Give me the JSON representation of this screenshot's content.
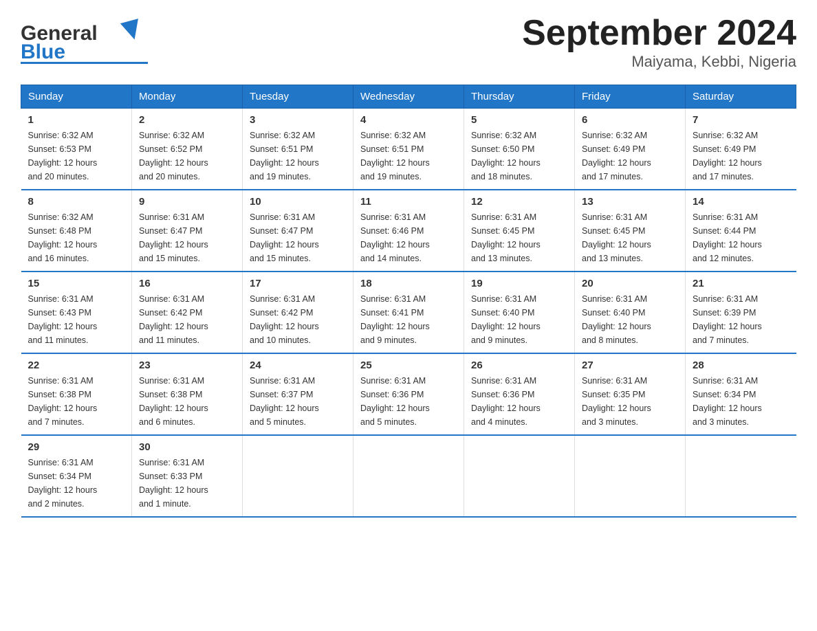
{
  "header": {
    "logo_general": "General",
    "logo_blue": "Blue",
    "title": "September 2024",
    "location": "Maiyama, Kebbi, Nigeria"
  },
  "calendar": {
    "days_of_week": [
      "Sunday",
      "Monday",
      "Tuesday",
      "Wednesday",
      "Thursday",
      "Friday",
      "Saturday"
    ],
    "weeks": [
      [
        {
          "day": "1",
          "info": "Sunrise: 6:32 AM\nSunset: 6:53 PM\nDaylight: 12 hours\nand 20 minutes."
        },
        {
          "day": "2",
          "info": "Sunrise: 6:32 AM\nSunset: 6:52 PM\nDaylight: 12 hours\nand 20 minutes."
        },
        {
          "day": "3",
          "info": "Sunrise: 6:32 AM\nSunset: 6:51 PM\nDaylight: 12 hours\nand 19 minutes."
        },
        {
          "day": "4",
          "info": "Sunrise: 6:32 AM\nSunset: 6:51 PM\nDaylight: 12 hours\nand 19 minutes."
        },
        {
          "day": "5",
          "info": "Sunrise: 6:32 AM\nSunset: 6:50 PM\nDaylight: 12 hours\nand 18 minutes."
        },
        {
          "day": "6",
          "info": "Sunrise: 6:32 AM\nSunset: 6:49 PM\nDaylight: 12 hours\nand 17 minutes."
        },
        {
          "day": "7",
          "info": "Sunrise: 6:32 AM\nSunset: 6:49 PM\nDaylight: 12 hours\nand 17 minutes."
        }
      ],
      [
        {
          "day": "8",
          "info": "Sunrise: 6:32 AM\nSunset: 6:48 PM\nDaylight: 12 hours\nand 16 minutes."
        },
        {
          "day": "9",
          "info": "Sunrise: 6:31 AM\nSunset: 6:47 PM\nDaylight: 12 hours\nand 15 minutes."
        },
        {
          "day": "10",
          "info": "Sunrise: 6:31 AM\nSunset: 6:47 PM\nDaylight: 12 hours\nand 15 minutes."
        },
        {
          "day": "11",
          "info": "Sunrise: 6:31 AM\nSunset: 6:46 PM\nDaylight: 12 hours\nand 14 minutes."
        },
        {
          "day": "12",
          "info": "Sunrise: 6:31 AM\nSunset: 6:45 PM\nDaylight: 12 hours\nand 13 minutes."
        },
        {
          "day": "13",
          "info": "Sunrise: 6:31 AM\nSunset: 6:45 PM\nDaylight: 12 hours\nand 13 minutes."
        },
        {
          "day": "14",
          "info": "Sunrise: 6:31 AM\nSunset: 6:44 PM\nDaylight: 12 hours\nand 12 minutes."
        }
      ],
      [
        {
          "day": "15",
          "info": "Sunrise: 6:31 AM\nSunset: 6:43 PM\nDaylight: 12 hours\nand 11 minutes."
        },
        {
          "day": "16",
          "info": "Sunrise: 6:31 AM\nSunset: 6:42 PM\nDaylight: 12 hours\nand 11 minutes."
        },
        {
          "day": "17",
          "info": "Sunrise: 6:31 AM\nSunset: 6:42 PM\nDaylight: 12 hours\nand 10 minutes."
        },
        {
          "day": "18",
          "info": "Sunrise: 6:31 AM\nSunset: 6:41 PM\nDaylight: 12 hours\nand 9 minutes."
        },
        {
          "day": "19",
          "info": "Sunrise: 6:31 AM\nSunset: 6:40 PM\nDaylight: 12 hours\nand 9 minutes."
        },
        {
          "day": "20",
          "info": "Sunrise: 6:31 AM\nSunset: 6:40 PM\nDaylight: 12 hours\nand 8 minutes."
        },
        {
          "day": "21",
          "info": "Sunrise: 6:31 AM\nSunset: 6:39 PM\nDaylight: 12 hours\nand 7 minutes."
        }
      ],
      [
        {
          "day": "22",
          "info": "Sunrise: 6:31 AM\nSunset: 6:38 PM\nDaylight: 12 hours\nand 7 minutes."
        },
        {
          "day": "23",
          "info": "Sunrise: 6:31 AM\nSunset: 6:38 PM\nDaylight: 12 hours\nand 6 minutes."
        },
        {
          "day": "24",
          "info": "Sunrise: 6:31 AM\nSunset: 6:37 PM\nDaylight: 12 hours\nand 5 minutes."
        },
        {
          "day": "25",
          "info": "Sunrise: 6:31 AM\nSunset: 6:36 PM\nDaylight: 12 hours\nand 5 minutes."
        },
        {
          "day": "26",
          "info": "Sunrise: 6:31 AM\nSunset: 6:36 PM\nDaylight: 12 hours\nand 4 minutes."
        },
        {
          "day": "27",
          "info": "Sunrise: 6:31 AM\nSunset: 6:35 PM\nDaylight: 12 hours\nand 3 minutes."
        },
        {
          "day": "28",
          "info": "Sunrise: 6:31 AM\nSunset: 6:34 PM\nDaylight: 12 hours\nand 3 minutes."
        }
      ],
      [
        {
          "day": "29",
          "info": "Sunrise: 6:31 AM\nSunset: 6:34 PM\nDaylight: 12 hours\nand 2 minutes."
        },
        {
          "day": "30",
          "info": "Sunrise: 6:31 AM\nSunset: 6:33 PM\nDaylight: 12 hours\nand 1 minute."
        },
        {
          "day": "",
          "info": ""
        },
        {
          "day": "",
          "info": ""
        },
        {
          "day": "",
          "info": ""
        },
        {
          "day": "",
          "info": ""
        },
        {
          "day": "",
          "info": ""
        }
      ]
    ]
  }
}
